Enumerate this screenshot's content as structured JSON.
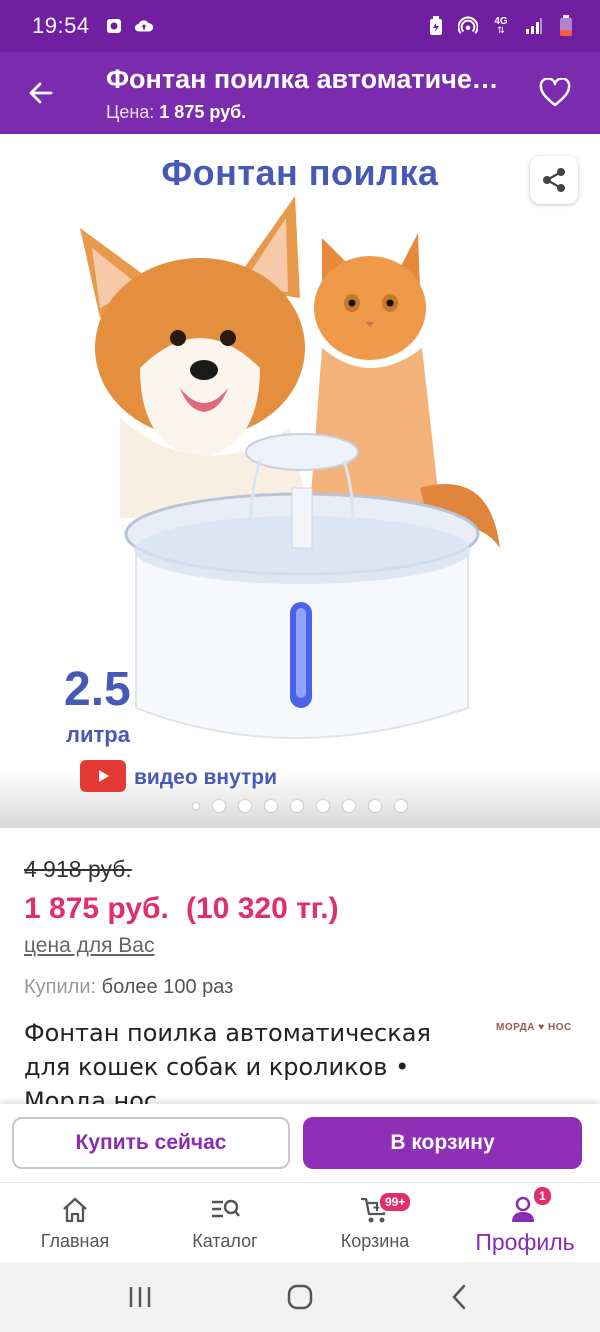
{
  "status_bar": {
    "time": "19:54",
    "left_icons": [
      "notification-icon",
      "cloud-upload-icon"
    ],
    "right_icons": [
      "battery-saver-icon",
      "hotspot-icon",
      "network-4g-icon",
      "signal-icon",
      "battery-icon"
    ],
    "network_label": "4G"
  },
  "app_bar": {
    "title": "Фонтан поилка автоматическая для кошек собак и кроликов • Морда нос",
    "price_label": "Цена:",
    "price_value": "1 875 руб."
  },
  "hero": {
    "title": "Фонтан поилка",
    "liters_number": "2.5",
    "liters_word": "литра",
    "video_text": "видео внутри",
    "image_count": 9,
    "current_image": 1
  },
  "product": {
    "old_price": "4 918 руб.",
    "new_price": "1 875 руб.",
    "price_tg": "(10 320 тг.)",
    "price_note": "цена для Вас",
    "bought_label": "Купили:",
    "bought_value": "более 100 раз",
    "name": "Фонтан поилка автоматическая для кошек собак и кроликов • Морда нос",
    "brand_logo": "МОРДА ♥ НОС"
  },
  "actions": {
    "buy_now": "Купить сейчас",
    "add_to_cart": "В корзину"
  },
  "bottom_nav": {
    "items": [
      {
        "label": "Главная",
        "icon": "home-icon"
      },
      {
        "label": "Каталог",
        "icon": "catalog-search-icon"
      },
      {
        "label": "Корзина",
        "icon": "cart-icon",
        "badge": "99+"
      },
      {
        "label": "Профиль",
        "icon": "profile-icon",
        "badge": "1"
      }
    ],
    "active_index": 3
  },
  "colors": {
    "status_bar": "#6f1fa0",
    "app_bar": "#7b2bad",
    "accent": "#8f2fb8",
    "price": "#e0306b",
    "hero_text": "#4759b6"
  }
}
